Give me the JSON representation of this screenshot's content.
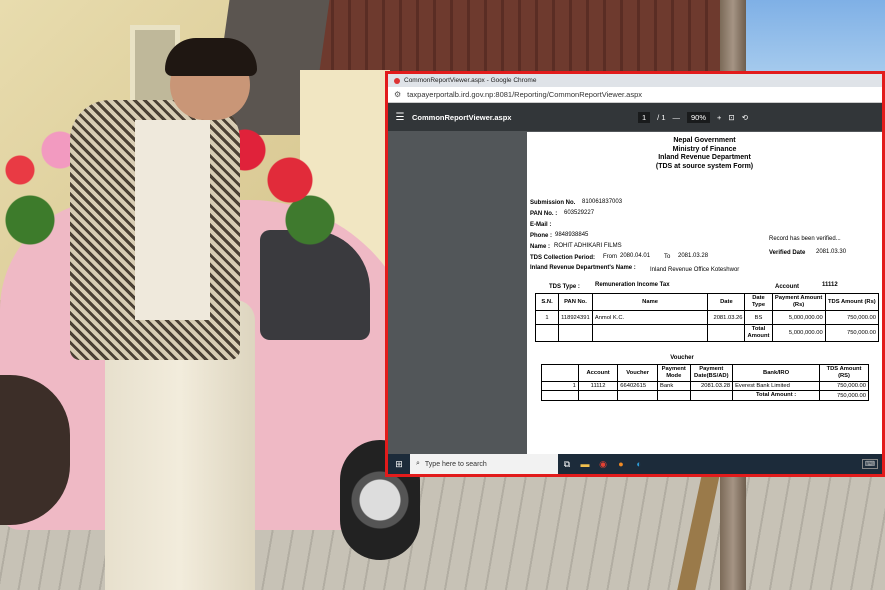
{
  "browser": {
    "window_title": "CommonReportViewer.aspx - Google Chrome",
    "url": "taxpayerportalb.ird.gov.np:8081/Reporting/CommonReportViewer.aspx"
  },
  "pdf_toolbar": {
    "title": "CommonReportViewer.aspx",
    "page_current": "1",
    "page_total": "/ 1",
    "zoom": "90%",
    "minus": "—",
    "plus": "+"
  },
  "report": {
    "header": [
      "Nepal Government",
      "Ministry of Finance",
      "Inland Revenue Department",
      "(TDS at source system Form)"
    ],
    "submission_label": "Submission No.",
    "submission_value": "810061837003",
    "pan_label": "PAN No. :",
    "pan_value": "603529227",
    "email_label": "E-Mail :",
    "phone_label": "Phone :",
    "phone_value": "9848938845",
    "name_label": "Name :",
    "name_value": "ROHIT ADHIKARI FILMS",
    "period_label": "TDS Collection Period:",
    "period_from_label": "From",
    "period_from": "2080.04.01",
    "period_to_label": "To",
    "period_to": "2081.03.28",
    "office_label": "Inland Revenue Department's Name :",
    "office_value": "Inland Revenue Office Koteshwor",
    "verified_note": "Record has been verified...",
    "verified_date_label": "Verified Date",
    "verified_date": "2081.03.30",
    "tds_type_label": "TDS Type :",
    "tds_type_value": "Remuneration Income Tax",
    "account_label": "Account",
    "account_value": "11112",
    "table1": {
      "headers": [
        "S.N.",
        "PAN No.",
        "Name",
        "Date",
        "Date Type",
        "Payment Amount (Rs)",
        "TDS Amount (Rs)"
      ],
      "row": [
        "1",
        "118924391",
        "Anmol K.C.",
        "2081.03.26",
        "BS",
        "5,000,000.00",
        "750,000.00"
      ],
      "total_label": "Total Amount",
      "total_payment": "5,000,000.00",
      "total_tds": "750,000.00"
    },
    "voucher_title": "Voucher",
    "table2": {
      "headers": [
        "Account",
        "Voucher",
        "Payment Mode",
        "Payment Date(BS/AD)",
        "Bank/IRO",
        "TDS Amount (RS)"
      ],
      "row": [
        "1",
        "11112",
        "66402615",
        "Bank",
        "2081.03.28",
        "Everest Bank Limited",
        "750,000.00"
      ],
      "total_label": "Total Amount :",
      "total_value": "750,000.00"
    }
  },
  "taskbar": {
    "search_placeholder": "Type here to search"
  }
}
